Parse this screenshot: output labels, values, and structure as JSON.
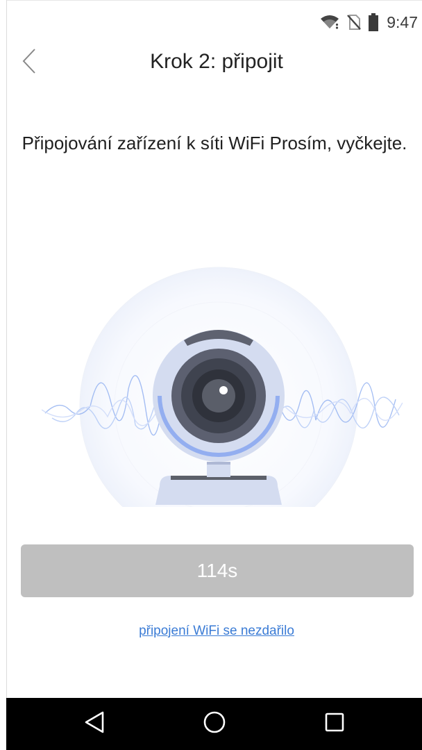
{
  "status_bar": {
    "time": "9:47",
    "icons": [
      "wifi-icon",
      "no-sim-icon",
      "battery-icon"
    ]
  },
  "header": {
    "back_icon": "chevron-left-icon",
    "title": "Krok 2: připojit"
  },
  "message": {
    "text": "Připojování zařízení k síti WiFi Prosím, vyčkejte."
  },
  "illustration": {
    "icon": "webcam-icon",
    "accent_color": "#8fb0f5",
    "body_color": "#d4dcf0"
  },
  "timer_button": {
    "label": "114s",
    "color": "#bfbfbf"
  },
  "fail_link": {
    "label": "připojení WiFi se nezdařilo",
    "color": "#3a7bd5"
  },
  "nav_bar": {
    "icons": [
      "back-triangle-icon",
      "home-circle-icon",
      "recents-square-icon"
    ]
  }
}
